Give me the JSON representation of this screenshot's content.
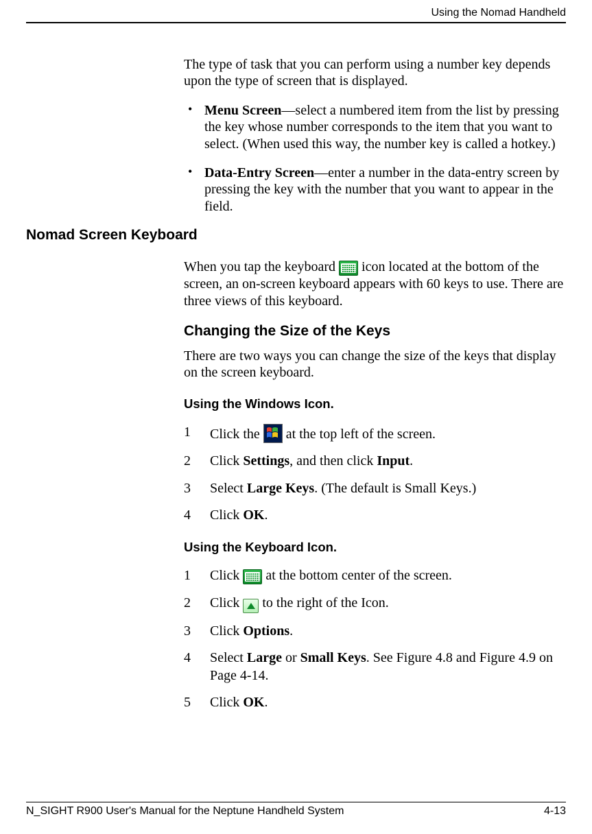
{
  "header": {
    "running_title": "Using the Nomad Handheld"
  },
  "intro": {
    "p1": "The type of task that you can perform using a number key depends upon the type of screen that is displayed."
  },
  "bullets": {
    "b1_label": "Menu Screen",
    "b1_rest": "—select a numbered item from the list by pressing the key whose number corresponds to the item that you want to select. (When used this way, the number key is called a hotkey.)",
    "b2_label": "Data-Entry Screen",
    "b2_rest": "—enter a number in the data-entry screen by pressing the key with the number that you want to appear in the field."
  },
  "sections": {
    "nomad_title": "Nomad Screen Keyboard",
    "nomad_p_pre": "When you tap the keyboard ",
    "nomad_p_post": " icon located at the bottom of the screen, an on-screen keyboard appears with 60 keys to use. There are three views of this keyboard.",
    "changing_title": "Changing the Size of the Keys",
    "changing_p": "There are two ways you can change the size of the keys that display on the screen keyboard.",
    "winicon_title": "Using the Windows Icon.",
    "kbdicon_title": "Using the Keyboard Icon."
  },
  "steps_win": {
    "s1_pre": "Click the ",
    "s1_post": " at the top left of the screen.",
    "s2_a": "Click ",
    "s2_b": "Settings",
    "s2_c": ", and then click ",
    "s2_d": "Input",
    "s2_e": ".",
    "s3_a": "Select ",
    "s3_b": "Large Keys",
    "s3_c": ". (The default is Small Keys.)",
    "s4_a": "Click ",
    "s4_b": "OK",
    "s4_c": "."
  },
  "steps_kbd": {
    "s1_pre": "Click ",
    "s1_post": " at the bottom center of the screen.",
    "s2_pre": "Click ",
    "s2_post": " to the right of the Icon.",
    "s3_a": "Click ",
    "s3_b": "Options",
    "s3_c": ".",
    "s4_a": "Select ",
    "s4_b": "Large",
    "s4_c": " or ",
    "s4_d": "Small Keys",
    "s4_e": ". See Figure 4.8 and Figure 4.9 on Page 4-14.",
    "s5_a": "Click ",
    "s5_b": "OK",
    "s5_c": "."
  },
  "footer": {
    "left": "N_SIGHT R900 User's Manual for the Neptune Handheld System",
    "right": "4-13"
  }
}
